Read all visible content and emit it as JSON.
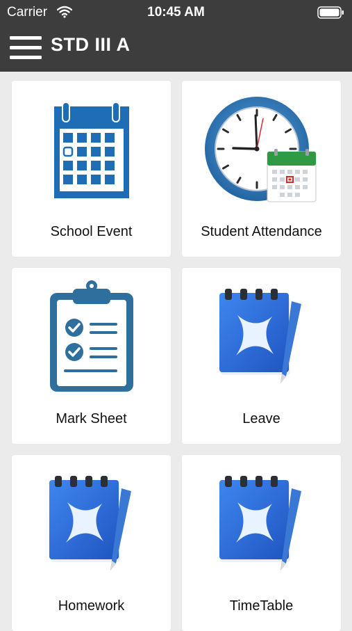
{
  "status_bar": {
    "carrier": "Carrier",
    "time": "10:45 AM",
    "wifi_icon": "wifi-icon",
    "battery_icon": "battery-icon"
  },
  "nav_bar": {
    "title": "STD III A",
    "menu_icon": "hamburger-menu-icon"
  },
  "tiles": [
    {
      "label": "School Event",
      "icon": "calendar-icon"
    },
    {
      "label": "Student Attendance",
      "icon": "clock-calendar-icon"
    },
    {
      "label": "Mark Sheet",
      "icon": "clipboard-checklist-icon"
    },
    {
      "label": "Leave",
      "icon": "notebook-pen-icon"
    },
    {
      "label": "Homework",
      "icon": "notebook-pen-icon"
    },
    {
      "label": "TimeTable",
      "icon": "notebook-pen-icon"
    }
  ],
  "colors": {
    "header": "#3d3d3d",
    "background": "#ebebeb",
    "card": "#ffffff",
    "calendar_blue": "#1f6eb5",
    "clipboard_blue": "#2f6f9e",
    "notebook_blue": "#2f6ed8"
  }
}
